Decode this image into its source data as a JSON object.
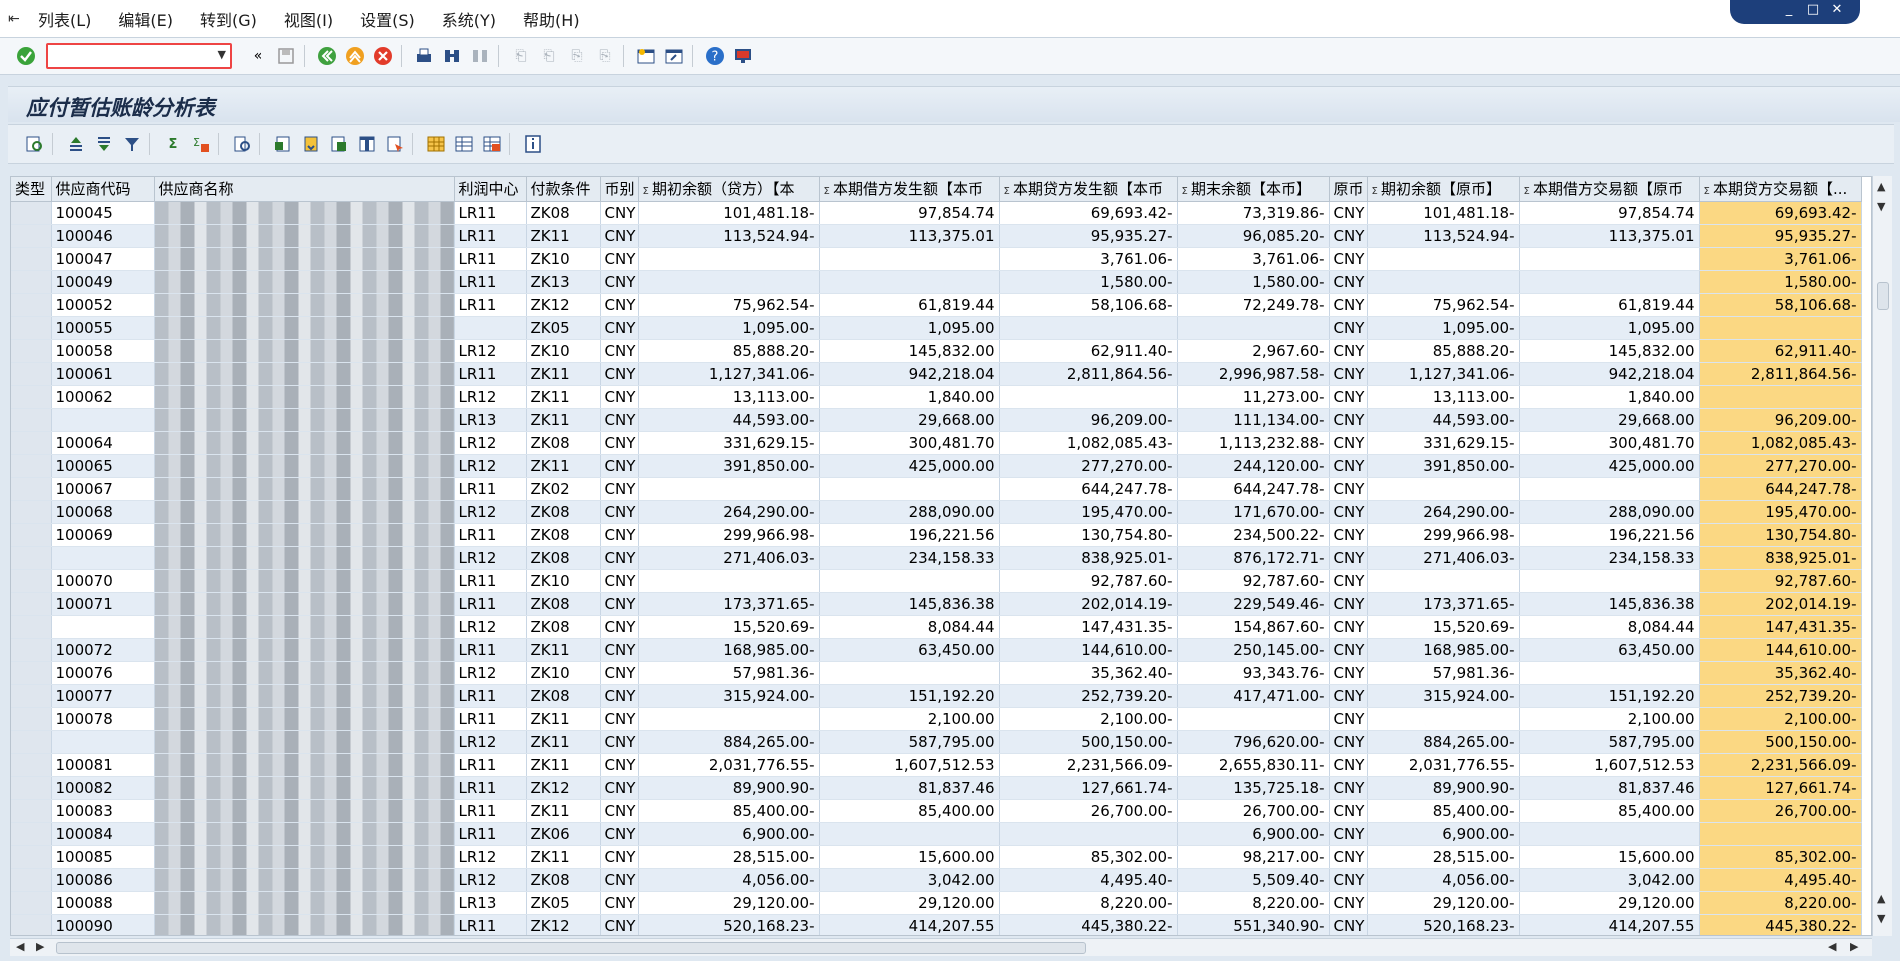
{
  "menu": [
    "列表(L)",
    "编辑(E)",
    "转到(G)",
    "视图(I)",
    "设置(S)",
    "系统(Y)",
    "帮助(H)"
  ],
  "window_controls": [
    "_",
    "□",
    "✕"
  ],
  "title": "应付暂估账龄分析表",
  "columns": [
    "类型",
    "供应商代码",
    "供应商名称",
    "利润中心",
    "付款条件",
    "币别",
    "期初余额（贷方）【本",
    "本期借方发生额【本币",
    "本期贷方发生额【本币",
    "期末余额【本币】",
    "原币",
    "期初余额【原币】",
    "本期借方交易额【原币",
    "本期贷方交易额【..."
  ],
  "rows": [
    {
      "code": "100045",
      "pc": "LR11",
      "term": "ZK08",
      "cur": "CNY",
      "a": "101,481.18-",
      "b": "97,854.74",
      "c": "69,693.42-",
      "d": "73,319.86-",
      "oc": "CNY",
      "e": "101,481.18-",
      "f": "97,854.74",
      "g": "69,693.42-"
    },
    {
      "code": "100046",
      "pc": "LR11",
      "term": "ZK11",
      "cur": "CNY",
      "a": "113,524.94-",
      "b": "113,375.01",
      "c": "95,935.27-",
      "d": "96,085.20-",
      "oc": "CNY",
      "e": "113,524.94-",
      "f": "113,375.01",
      "g": "95,935.27-"
    },
    {
      "code": "100047",
      "pc": "LR11",
      "term": "ZK10",
      "cur": "CNY",
      "a": "",
      "b": "",
      "c": "3,761.06-",
      "d": "3,761.06-",
      "oc": "CNY",
      "e": "",
      "f": "",
      "g": "3,761.06-"
    },
    {
      "code": "100049",
      "pc": "LR11",
      "term": "ZK13",
      "cur": "CNY",
      "a": "",
      "b": "",
      "c": "1,580.00-",
      "d": "1,580.00-",
      "oc": "CNY",
      "e": "",
      "f": "",
      "g": "1,580.00-"
    },
    {
      "code": "100052",
      "pc": "LR11",
      "term": "ZK12",
      "cur": "CNY",
      "a": "75,962.54-",
      "b": "61,819.44",
      "c": "58,106.68-",
      "d": "72,249.78-",
      "oc": "CNY",
      "e": "75,962.54-",
      "f": "61,819.44",
      "g": "58,106.68-"
    },
    {
      "code": "100055",
      "pc": "",
      "term": "ZK05",
      "cur": "CNY",
      "a": "1,095.00-",
      "b": "1,095.00",
      "c": "",
      "d": "",
      "oc": "CNY",
      "e": "1,095.00-",
      "f": "1,095.00",
      "g": ""
    },
    {
      "code": "100058",
      "pc": "LR12",
      "term": "ZK10",
      "cur": "CNY",
      "a": "85,888.20-",
      "b": "145,832.00",
      "c": "62,911.40-",
      "d": "2,967.60-",
      "oc": "CNY",
      "e": "85,888.20-",
      "f": "145,832.00",
      "g": "62,911.40-"
    },
    {
      "code": "100061",
      "pc": "LR11",
      "term": "ZK11",
      "cur": "CNY",
      "a": "1,127,341.06-",
      "b": "942,218.04",
      "c": "2,811,864.56-",
      "d": "2,996,987.58-",
      "oc": "CNY",
      "e": "1,127,341.06-",
      "f": "942,218.04",
      "g": "2,811,864.56-"
    },
    {
      "code": "100062",
      "pc": "LR12",
      "term": "ZK11",
      "cur": "CNY",
      "a": "13,113.00-",
      "b": "1,840.00",
      "c": "",
      "d": "11,273.00-",
      "oc": "CNY",
      "e": "13,113.00-",
      "f": "1,840.00",
      "g": ""
    },
    {
      "code": "",
      "pc": "LR13",
      "term": "ZK11",
      "cur": "CNY",
      "a": "44,593.00-",
      "b": "29,668.00",
      "c": "96,209.00-",
      "d": "111,134.00-",
      "oc": "CNY",
      "e": "44,593.00-",
      "f": "29,668.00",
      "g": "96,209.00-"
    },
    {
      "code": "100064",
      "pc": "LR12",
      "term": "ZK08",
      "cur": "CNY",
      "a": "331,629.15-",
      "b": "300,481.70",
      "c": "1,082,085.43-",
      "d": "1,113,232.88-",
      "oc": "CNY",
      "e": "331,629.15-",
      "f": "300,481.70",
      "g": "1,082,085.43-"
    },
    {
      "code": "100065",
      "pc": "LR12",
      "term": "ZK11",
      "cur": "CNY",
      "a": "391,850.00-",
      "b": "425,000.00",
      "c": "277,270.00-",
      "d": "244,120.00-",
      "oc": "CNY",
      "e": "391,850.00-",
      "f": "425,000.00",
      "g": "277,270.00-"
    },
    {
      "code": "100067",
      "pc": "LR11",
      "term": "ZK02",
      "cur": "CNY",
      "a": "",
      "b": "",
      "c": "644,247.78-",
      "d": "644,247.78-",
      "oc": "CNY",
      "e": "",
      "f": "",
      "g": "644,247.78-"
    },
    {
      "code": "100068",
      "pc": "LR12",
      "term": "ZK08",
      "cur": "CNY",
      "a": "264,290.00-",
      "b": "288,090.00",
      "c": "195,470.00-",
      "d": "171,670.00-",
      "oc": "CNY",
      "e": "264,290.00-",
      "f": "288,090.00",
      "g": "195,470.00-"
    },
    {
      "code": "100069",
      "pc": "LR11",
      "term": "ZK08",
      "cur": "CNY",
      "a": "299,966.98-",
      "b": "196,221.56",
      "c": "130,754.80-",
      "d": "234,500.22-",
      "oc": "CNY",
      "e": "299,966.98-",
      "f": "196,221.56",
      "g": "130,754.80-"
    },
    {
      "code": "",
      "pc": "LR12",
      "term": "ZK08",
      "cur": "CNY",
      "a": "271,406.03-",
      "b": "234,158.33",
      "c": "838,925.01-",
      "d": "876,172.71-",
      "oc": "CNY",
      "e": "271,406.03-",
      "f": "234,158.33",
      "g": "838,925.01-"
    },
    {
      "code": "100070",
      "pc": "LR11",
      "term": "ZK10",
      "cur": "CNY",
      "a": "",
      "b": "",
      "c": "92,787.60-",
      "d": "92,787.60-",
      "oc": "CNY",
      "e": "",
      "f": "",
      "g": "92,787.60-"
    },
    {
      "code": "100071",
      "pc": "LR11",
      "term": "ZK08",
      "cur": "CNY",
      "a": "173,371.65-",
      "b": "145,836.38",
      "c": "202,014.19-",
      "d": "229,549.46-",
      "oc": "CNY",
      "e": "173,371.65-",
      "f": "145,836.38",
      "g": "202,014.19-"
    },
    {
      "code": "",
      "pc": "LR12",
      "term": "ZK08",
      "cur": "CNY",
      "a": "15,520.69-",
      "b": "8,084.44",
      "c": "147,431.35-",
      "d": "154,867.60-",
      "oc": "CNY",
      "e": "15,520.69-",
      "f": "8,084.44",
      "g": "147,431.35-"
    },
    {
      "code": "100072",
      "pc": "LR11",
      "term": "ZK11",
      "cur": "CNY",
      "a": "168,985.00-",
      "b": "63,450.00",
      "c": "144,610.00-",
      "d": "250,145.00-",
      "oc": "CNY",
      "e": "168,985.00-",
      "f": "63,450.00",
      "g": "144,610.00-"
    },
    {
      "code": "100076",
      "pc": "LR12",
      "term": "ZK10",
      "cur": "CNY",
      "a": "57,981.36-",
      "b": "",
      "c": "35,362.40-",
      "d": "93,343.76-",
      "oc": "CNY",
      "e": "57,981.36-",
      "f": "",
      "g": "35,362.40-"
    },
    {
      "code": "100077",
      "pc": "LR11",
      "term": "ZK08",
      "cur": "CNY",
      "a": "315,924.00-",
      "b": "151,192.20",
      "c": "252,739.20-",
      "d": "417,471.00-",
      "oc": "CNY",
      "e": "315,924.00-",
      "f": "151,192.20",
      "g": "252,739.20-"
    },
    {
      "code": "100078",
      "pc": "LR11",
      "term": "ZK11",
      "cur": "CNY",
      "a": "",
      "b": "2,100.00",
      "c": "2,100.00-",
      "d": "",
      "oc": "CNY",
      "e": "",
      "f": "2,100.00",
      "g": "2,100.00-"
    },
    {
      "code": "",
      "pc": "LR12",
      "term": "ZK11",
      "cur": "CNY",
      "a": "884,265.00-",
      "b": "587,795.00",
      "c": "500,150.00-",
      "d": "796,620.00-",
      "oc": "CNY",
      "e": "884,265.00-",
      "f": "587,795.00",
      "g": "500,150.00-"
    },
    {
      "code": "100081",
      "pc": "LR11",
      "term": "ZK11",
      "cur": "CNY",
      "a": "2,031,776.55-",
      "b": "1,607,512.53",
      "c": "2,231,566.09-",
      "d": "2,655,830.11-",
      "oc": "CNY",
      "e": "2,031,776.55-",
      "f": "1,607,512.53",
      "g": "2,231,566.09-"
    },
    {
      "code": "100082",
      "pc": "LR11",
      "term": "ZK12",
      "cur": "CNY",
      "a": "89,900.90-",
      "b": "81,837.46",
      "c": "127,661.74-",
      "d": "135,725.18-",
      "oc": "CNY",
      "e": "89,900.90-",
      "f": "81,837.46",
      "g": "127,661.74-"
    },
    {
      "code": "100083",
      "pc": "LR11",
      "term": "ZK11",
      "cur": "CNY",
      "a": "85,400.00-",
      "b": "85,400.00",
      "c": "26,700.00-",
      "d": "26,700.00-",
      "oc": "CNY",
      "e": "85,400.00-",
      "f": "85,400.00",
      "g": "26,700.00-"
    },
    {
      "code": "100084",
      "pc": "LR11",
      "term": "ZK06",
      "cur": "CNY",
      "a": "6,900.00-",
      "b": "",
      "c": "",
      "d": "6,900.00-",
      "oc": "CNY",
      "e": "6,900.00-",
      "f": "",
      "g": ""
    },
    {
      "code": "100085",
      "pc": "LR12",
      "term": "ZK11",
      "cur": "CNY",
      "a": "28,515.00-",
      "b": "15,600.00",
      "c": "85,302.00-",
      "d": "98,217.00-",
      "oc": "CNY",
      "e": "28,515.00-",
      "f": "15,600.00",
      "g": "85,302.00-"
    },
    {
      "code": "100086",
      "pc": "LR12",
      "term": "ZK08",
      "cur": "CNY",
      "a": "4,056.00-",
      "b": "3,042.00",
      "c": "4,495.40-",
      "d": "5,509.40-",
      "oc": "CNY",
      "e": "4,056.00-",
      "f": "3,042.00",
      "g": "4,495.40-"
    },
    {
      "code": "100088",
      "pc": "LR13",
      "term": "ZK05",
      "cur": "CNY",
      "a": "29,120.00-",
      "b": "29,120.00",
      "c": "8,220.00-",
      "d": "8,220.00-",
      "oc": "CNY",
      "e": "29,120.00-",
      "f": "29,120.00",
      "g": "8,220.00-"
    },
    {
      "code": "100090",
      "pc": "LR11",
      "term": "ZK12",
      "cur": "CNY",
      "a": "520,168.23-",
      "b": "414,207.55",
      "c": "445,380.22-",
      "d": "551,340.90-",
      "oc": "CNY",
      "e": "520,168.23-",
      "f": "414,207.55",
      "g": "445,380.22-"
    }
  ],
  "colors": {
    "highlight": "#fbd883",
    "header": "#e4ebf2",
    "alt_row": "#e5edf6"
  }
}
